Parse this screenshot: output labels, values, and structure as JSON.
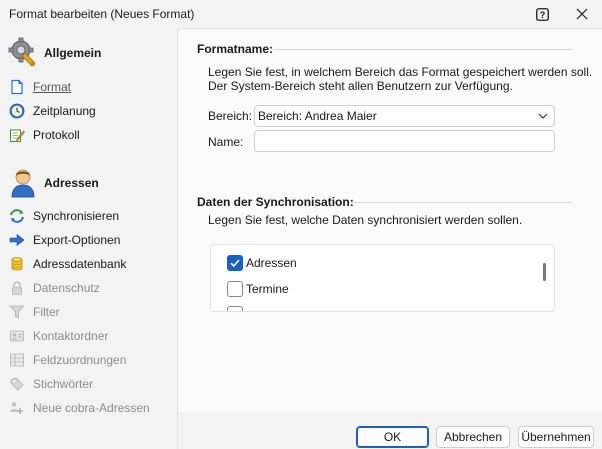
{
  "window": {
    "title": "Format bearbeiten (Neues Format)",
    "help_glyph": "?",
    "close_glyph": "✕"
  },
  "sidebar": {
    "sections": [
      {
        "label": "Allgemein",
        "icon": "gear-wrench-icon",
        "items": [
          {
            "label": "Format",
            "icon": "document-icon",
            "state": "active"
          },
          {
            "label": "Zeitplanung",
            "icon": "clock-icon",
            "state": "normal"
          },
          {
            "label": "Protokoll",
            "icon": "log-pencil-icon",
            "state": "normal"
          }
        ]
      },
      {
        "label": "Adressen",
        "icon": "person-icon",
        "items": [
          {
            "label": "Synchronisieren",
            "icon": "sync-arrows-icon",
            "state": "normal"
          },
          {
            "label": "Export-Optionen",
            "icon": "arrow-right-icon",
            "state": "normal"
          },
          {
            "label": "Adressdatenbank",
            "icon": "database-icon",
            "state": "normal"
          },
          {
            "label": "Datenschutz",
            "icon": "lock-icon",
            "state": "disabled"
          },
          {
            "label": "Filter",
            "icon": "funnel-icon",
            "state": "disabled"
          },
          {
            "label": "Kontaktordner",
            "icon": "contact-card-icon",
            "state": "disabled"
          },
          {
            "label": "Feldzuordnungen",
            "icon": "grid-icon",
            "state": "disabled"
          },
          {
            "label": "Stichwörter",
            "icon": "tags-icon",
            "state": "disabled"
          },
          {
            "label": "Neue cobra-Adressen",
            "icon": "people-add-icon",
            "state": "disabled"
          }
        ]
      }
    ]
  },
  "main": {
    "formatname": {
      "title": "Formatname:",
      "desc_line1": "Legen Sie fest, in welchem Bereich das Format gespeichert werden soll.",
      "desc_line2": "Der System-Bereich steht allen Benutzern zur Verfügung.",
      "bereich_label": "Bereich:",
      "bereich_value": "Bereich: Andrea Maier",
      "name_label": "Name:",
      "name_value": ""
    },
    "sync": {
      "title": "Daten der Synchronisation:",
      "desc": "Legen Sie fest, welche Daten synchronisiert werden sollen.",
      "options": [
        {
          "label": "Adressen",
          "checked": true
        },
        {
          "label": "Termine",
          "checked": false
        }
      ]
    }
  },
  "footer": {
    "ok_label": "OK",
    "cancel_label": "Abbrechen",
    "apply_label": "Übernehmen"
  },
  "colors": {
    "accent": "#1662c4",
    "disabled_text": "#8c8c8c"
  }
}
